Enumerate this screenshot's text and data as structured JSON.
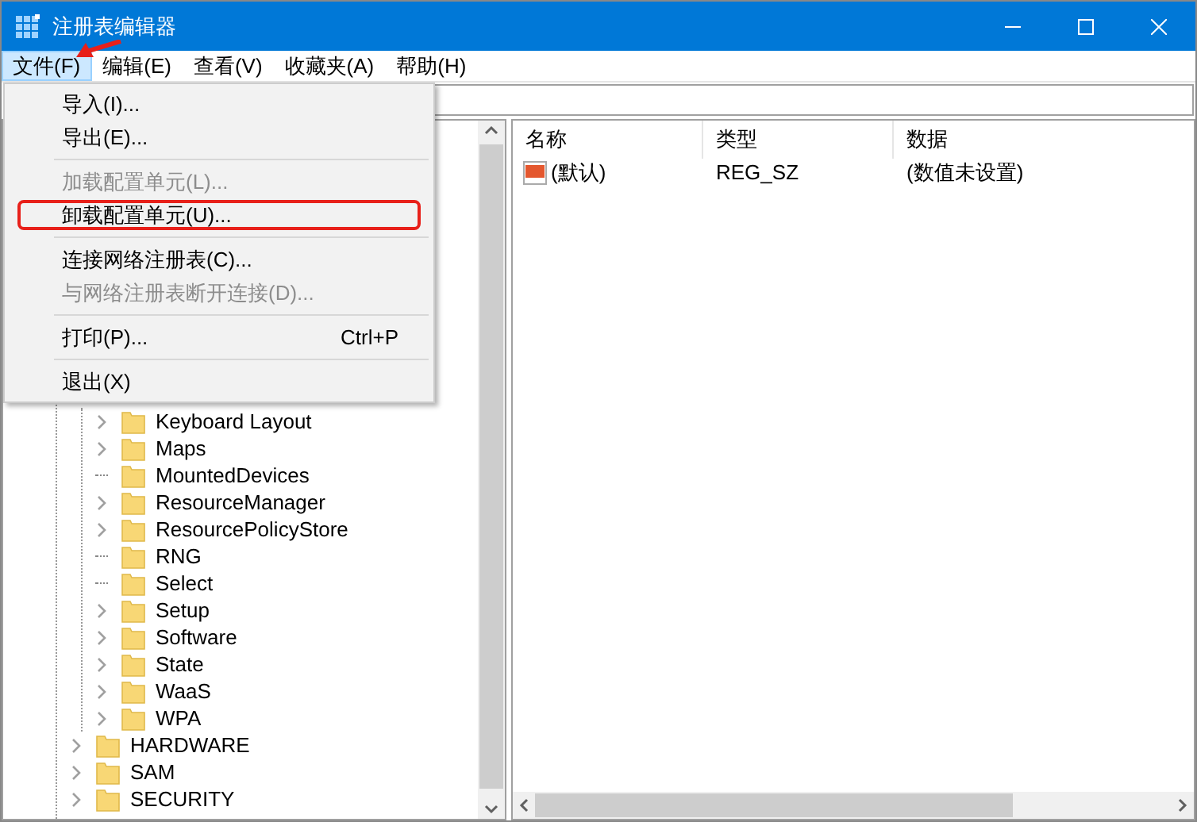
{
  "window": {
    "title": "注册表编辑器"
  },
  "menu_bar": [
    {
      "label": "文件(F)",
      "selected": true
    },
    {
      "label": "编辑(E)",
      "selected": false
    },
    {
      "label": "查看(V)",
      "selected": false
    },
    {
      "label": "收藏夹(A)",
      "selected": false
    },
    {
      "label": "帮助(H)",
      "selected": false
    }
  ],
  "file_menu": [
    {
      "kind": "item",
      "label": "导入(I)...",
      "disabled": false,
      "highlighted": false
    },
    {
      "kind": "item",
      "label": "导出(E)...",
      "disabled": false,
      "highlighted": false
    },
    {
      "kind": "separator"
    },
    {
      "kind": "item",
      "label": "加载配置单元(L)...",
      "disabled": true,
      "highlighted": false
    },
    {
      "kind": "item",
      "label": "卸载配置单元(U)...",
      "disabled": false,
      "highlighted": true
    },
    {
      "kind": "separator"
    },
    {
      "kind": "item",
      "label": "连接网络注册表(C)...",
      "disabled": false,
      "highlighted": false
    },
    {
      "kind": "item",
      "label": "与网络注册表断开连接(D)...",
      "disabled": true,
      "highlighted": false
    },
    {
      "kind": "separator"
    },
    {
      "kind": "item",
      "label": "打印(P)...",
      "shortcut": "Ctrl+P",
      "disabled": false,
      "highlighted": false
    },
    {
      "kind": "separator"
    },
    {
      "kind": "item",
      "label": "退出(X)",
      "disabled": false,
      "highlighted": false
    }
  ],
  "tree": [
    {
      "children": [
        {
          "label": "Keyboard Layout",
          "expandable": true
        },
        {
          "label": "Maps",
          "expandable": true
        },
        {
          "label": "MountedDevices",
          "expandable": false
        },
        {
          "label": "ResourceManager",
          "expandable": true
        },
        {
          "label": "ResourcePolicyStore",
          "expandable": true
        },
        {
          "label": "RNG",
          "expandable": false
        },
        {
          "label": "Select",
          "expandable": false
        },
        {
          "label": "Setup",
          "expandable": true
        },
        {
          "label": "Software",
          "expandable": true
        },
        {
          "label": "State",
          "expandable": true
        },
        {
          "label": "WaaS",
          "expandable": true
        },
        {
          "label": "WPA",
          "expandable": true
        }
      ]
    },
    {
      "label": "HARDWARE",
      "expandable": true
    },
    {
      "label": "SAM",
      "expandable": true
    },
    {
      "label": "SECURITY",
      "expandable": true
    }
  ],
  "values_table": {
    "columns": [
      "名称",
      "类型",
      "数据"
    ],
    "rows": [
      {
        "name": "(默认)",
        "type": "REG_SZ",
        "data": "(数值未设置)"
      }
    ]
  }
}
